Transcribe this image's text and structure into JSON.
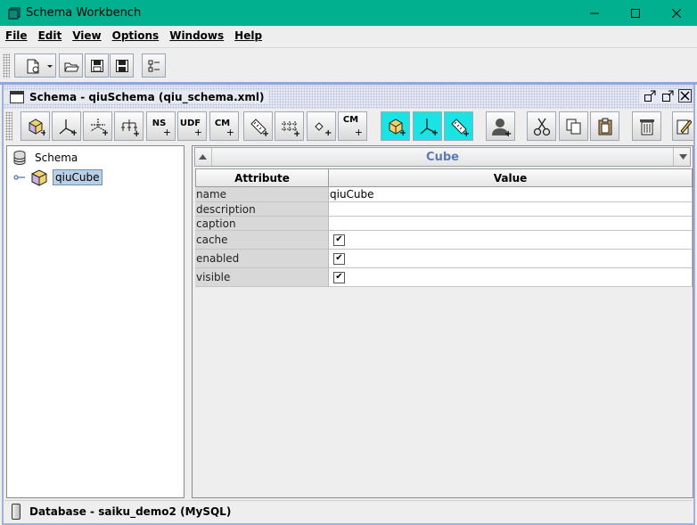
{
  "window": {
    "title": "Schema Workbench",
    "controls": [
      "minimize-icon",
      "maximize-icon",
      "close-icon"
    ]
  },
  "menu": [
    {
      "label": "File"
    },
    {
      "label": "Edit"
    },
    {
      "label": "View"
    },
    {
      "label": "Options"
    },
    {
      "label": "Windows"
    },
    {
      "label": "Help"
    }
  ],
  "main_toolbar": [
    "new-icon",
    "dropdown-arrow-icon",
    "open-icon",
    "save-icon",
    "save-as-icon",
    "preferences-icon"
  ],
  "schema_frame": {
    "title": "Schema - qiuSchema (qiu_schema.xml)",
    "frame_controls": [
      "restore-icon",
      "maximize-icon",
      "close-icon"
    ],
    "toolbar": [
      {
        "name": "add-cube",
        "label": ""
      },
      {
        "name": "add-dimension",
        "label": ""
      },
      {
        "name": "add-dimension-usage",
        "label": ""
      },
      {
        "name": "add-hierarchy",
        "label": ""
      },
      {
        "name": "add-named-set",
        "label": "NS"
      },
      {
        "name": "add-udf",
        "label": "UDF"
      },
      {
        "name": "add-calculated-member",
        "label": "CM"
      },
      {
        "name": "add-measure",
        "label": ""
      },
      {
        "name": "add-level",
        "label": ""
      },
      {
        "name": "add-property",
        "label": ""
      },
      {
        "name": "add-calculated-member-2",
        "label": "CM"
      },
      {
        "name": "add-virtual-cube",
        "label": ""
      },
      {
        "name": "add-virtual-dimension",
        "label": ""
      },
      {
        "name": "add-virtual-measure",
        "label": ""
      },
      {
        "name": "add-role",
        "label": ""
      },
      {
        "name": "cut",
        "label": ""
      },
      {
        "name": "copy",
        "label": ""
      },
      {
        "name": "paste",
        "label": ""
      },
      {
        "name": "delete",
        "label": ""
      },
      {
        "name": "edit",
        "label": ""
      }
    ],
    "tree": {
      "root": "Schema",
      "children": [
        {
          "label": "qiuCube",
          "selected": true
        }
      ]
    },
    "editor": {
      "element_title": "Cube",
      "columns": {
        "attribute": "Attribute",
        "value": "Value"
      },
      "rows": [
        {
          "attribute": "name",
          "value": "qiuCube",
          "type": "text"
        },
        {
          "attribute": "description",
          "value": "",
          "type": "text"
        },
        {
          "attribute": "caption",
          "value": "",
          "type": "text"
        },
        {
          "attribute": "cache",
          "value": "",
          "type": "checkbox",
          "checked": true
        },
        {
          "attribute": "enabled",
          "value": "",
          "type": "checkbox",
          "checked": true
        },
        {
          "attribute": "visible",
          "value": "",
          "type": "checkbox",
          "checked": true
        }
      ]
    },
    "status": "Database - saiku_demo2 (MySQL)"
  },
  "colors": {
    "titlebar": "#00b08f",
    "frame_border": "#9fb2dd",
    "selection": "#b8cfe5",
    "editor_title": "#5a7ab8",
    "virtual_button_bg": "#19e3e3"
  }
}
